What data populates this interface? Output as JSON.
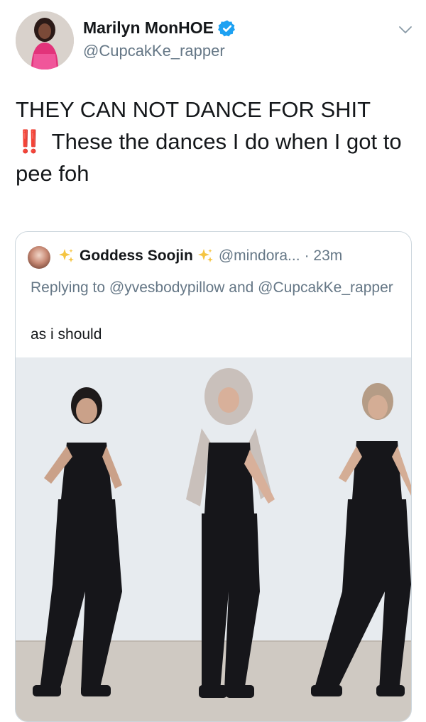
{
  "author": {
    "display_name": "Marilyn MonHOE",
    "handle": "@CupcakKe_rapper",
    "verified": true,
    "avatar_icon": "profile-photo"
  },
  "tweet": {
    "line1": "THEY CAN NOT DANCE FOR SHIT",
    "emoji": "‼️",
    "line2": "These the dances I do when I got to pee foh"
  },
  "quoted": {
    "display_name": "Goddess Soojin",
    "handle": "@mindora...",
    "time": "· 23m",
    "replying_to": "Replying to @yvesbodypillow and @CupcakKe_rapper",
    "text": "as i should",
    "media_icon": "video-thumbnail"
  },
  "colors": {
    "text": "#14171a",
    "secondary": "#657786",
    "verified": "#1da1f2",
    "border": "#ccd6dd",
    "bang": "#e0245e"
  }
}
